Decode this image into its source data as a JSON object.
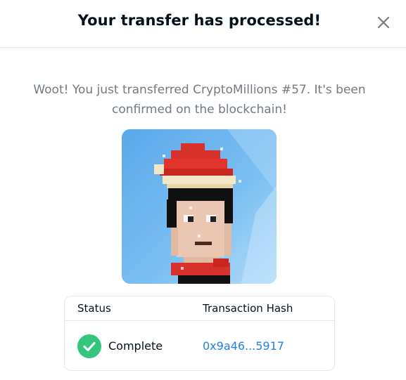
{
  "modal": {
    "title": "Your transfer has processed!",
    "close_icon": "close-icon"
  },
  "message": "Woot! You just transferred CryptoMillions #57. It's been confirmed on the blockchain!",
  "nft": {
    "name": "CryptoMillions #57",
    "background_color": "#6fb6ee"
  },
  "transaction_table": {
    "headers": [
      "Status",
      "Transaction Hash"
    ],
    "row": {
      "status": "Complete",
      "status_icon": "check-icon",
      "hash": "0x9a46...5917"
    }
  },
  "colors": {
    "accent_link": "#2081e2",
    "success": "#34c77b",
    "muted_text": "#707a83",
    "border": "#e5e8eb"
  }
}
